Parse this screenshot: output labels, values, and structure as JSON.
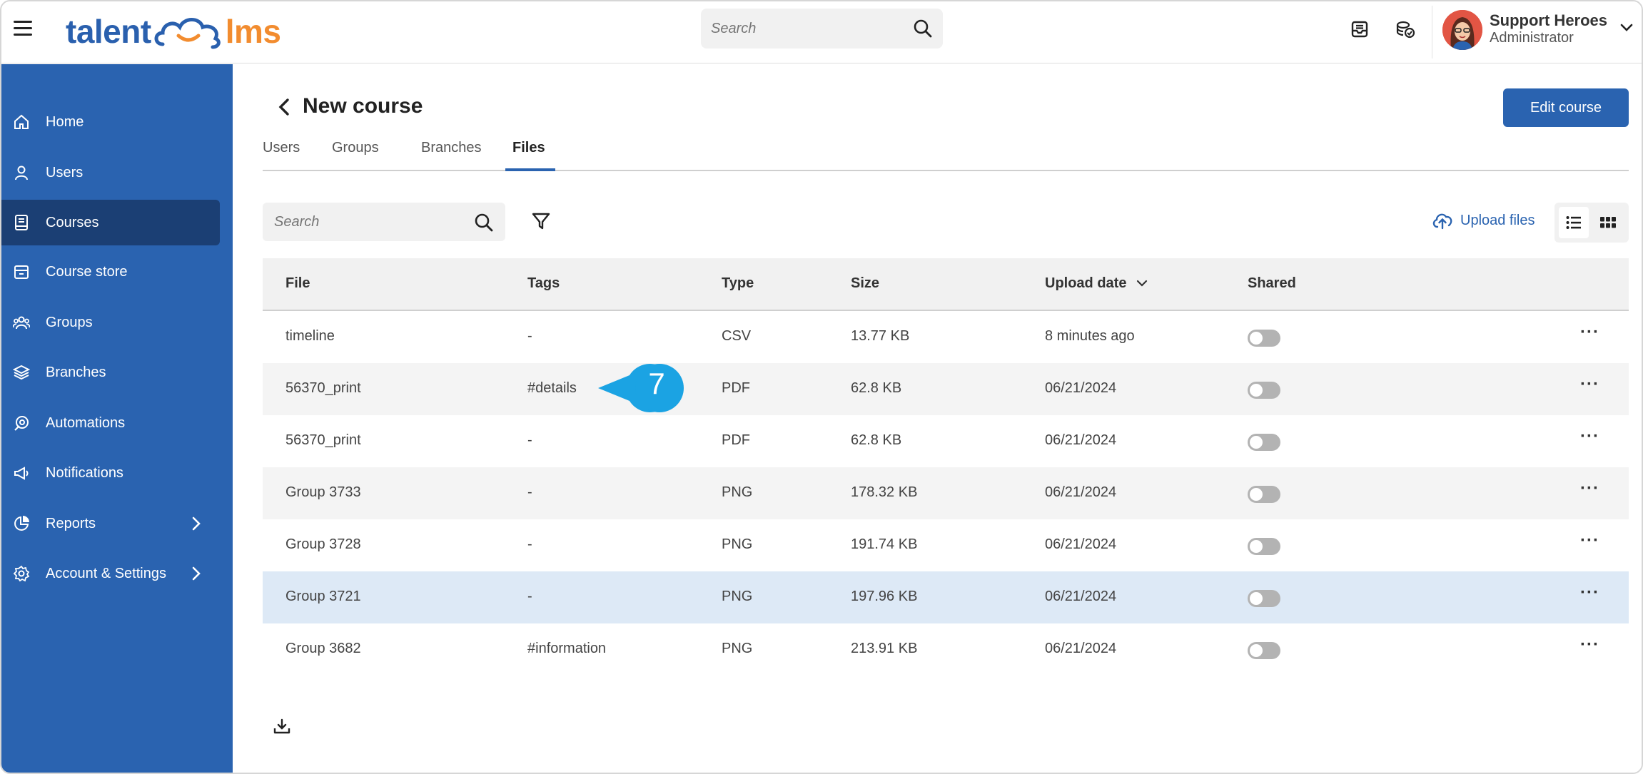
{
  "app": {
    "logo_text_left": "talent",
    "logo_text_right": "lms",
    "colors": {
      "brand_blue": "#2a63b0",
      "brand_orange": "#f28c2f",
      "sidebar_active": "#1b3f74",
      "selected_row": "#dde9f6"
    }
  },
  "topbar": {
    "search_placeholder": "Search",
    "user": {
      "name": "Support Heroes",
      "role": "Administrator"
    },
    "icons": [
      "menu-icon",
      "inbox-icon",
      "coins-icon",
      "search-icon",
      "chevron-down-icon"
    ]
  },
  "sidebar": {
    "items": [
      {
        "label": "Home",
        "icon": "home-icon",
        "active": false
      },
      {
        "label": "Users",
        "icon": "user-icon",
        "active": false
      },
      {
        "label": "Courses",
        "icon": "book-icon",
        "active": true
      },
      {
        "label": "Course store",
        "icon": "store-icon",
        "active": false
      },
      {
        "label": "Groups",
        "icon": "groups-icon",
        "active": false
      },
      {
        "label": "Branches",
        "icon": "layers-icon",
        "active": false
      },
      {
        "label": "Automations",
        "icon": "automation-icon",
        "active": false
      },
      {
        "label": "Notifications",
        "icon": "megaphone-icon",
        "active": false
      },
      {
        "label": "Reports",
        "icon": "pie-chart-icon",
        "active": false,
        "has_submenu": true
      },
      {
        "label": "Account & Settings",
        "icon": "gear-icon",
        "active": false,
        "has_submenu": true
      }
    ]
  },
  "page": {
    "title": "New course",
    "edit_button": "Edit course",
    "tabs": [
      {
        "label": "Users",
        "active": false
      },
      {
        "label": "Groups",
        "active": false
      },
      {
        "label": "Branches",
        "active": false
      },
      {
        "label": "Files",
        "active": true
      }
    ],
    "files_search_placeholder": "Search",
    "upload_label": "Upload files",
    "callout_number": "7"
  },
  "table": {
    "columns": [
      "File",
      "Tags",
      "Type",
      "Size",
      "Upload date",
      "Shared"
    ],
    "sort_column": "Upload date",
    "rows": [
      {
        "file": "timeline",
        "tags": "-",
        "type": "CSV",
        "size": "13.77 KB",
        "date": "8 minutes ago",
        "shared": false
      },
      {
        "file": "56370_print",
        "tags": "#details",
        "type": "PDF",
        "size": "62.8 KB",
        "date": "06/21/2024",
        "shared": false
      },
      {
        "file": "56370_print",
        "tags": "-",
        "type": "PDF",
        "size": "62.8 KB",
        "date": "06/21/2024",
        "shared": false
      },
      {
        "file": "Group 3733",
        "tags": "-",
        "type": "PNG",
        "size": "178.32 KB",
        "date": "06/21/2024",
        "shared": false
      },
      {
        "file": "Group 3728",
        "tags": "-",
        "type": "PNG",
        "size": "191.74 KB",
        "date": "06/21/2024",
        "shared": false
      },
      {
        "file": "Group 3721",
        "tags": "-",
        "type": "PNG",
        "size": "197.96 KB",
        "date": "06/21/2024",
        "shared": false,
        "selected": true
      },
      {
        "file": "Group 3682",
        "tags": "#information",
        "type": "PNG",
        "size": "213.91 KB",
        "date": "06/21/2024",
        "shared": false
      }
    ]
  }
}
